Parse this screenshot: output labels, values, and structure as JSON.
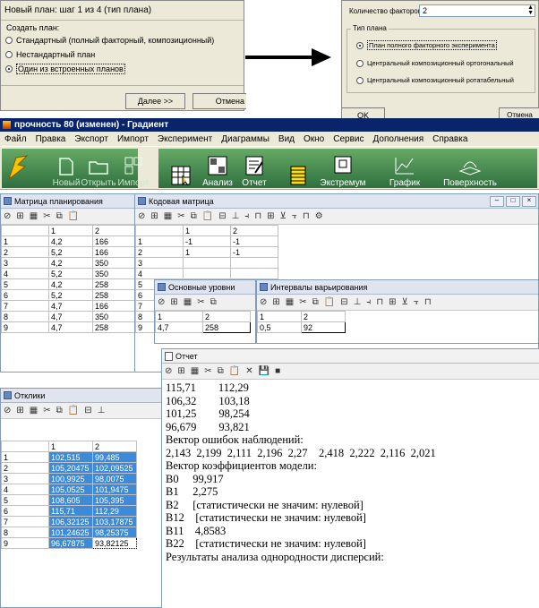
{
  "wizard": {
    "title": "Новый план: шаг 1 из 4 (тип плана)",
    "group_label": "Создать план:",
    "options": [
      {
        "label": "Стандартный (полный факторный, композиционный)",
        "selected": false
      },
      {
        "label": "Нестандартный план",
        "selected": false
      },
      {
        "label": "Один из встроенных планов",
        "selected": true
      }
    ],
    "next_label": "Далее >>",
    "cancel_label": "Отмена"
  },
  "wizard2": {
    "factors_label": "Количество факторов:",
    "factors_value": "2",
    "group_label": "Тип плана",
    "options": [
      {
        "label": "План полного факторного эксперимента",
        "selected": true
      },
      {
        "label": "Центральный композиционный ортогональный",
        "selected": false
      },
      {
        "label": "Центральный композиционный ротатабельный",
        "selected": false
      }
    ],
    "ok_label": "OK",
    "cancel_label": "Отмена"
  },
  "app": {
    "title": "прочность 80 (изменен) - Градиент",
    "menu": [
      "Файл",
      "Правка",
      "Экспорт",
      "Импорт",
      "Эксперимент",
      "Диаграммы",
      "Вид",
      "Окно",
      "Сервис",
      "Дополнения",
      "Справка"
    ],
    "toolbar": {
      "new": "Новый",
      "open": "Открыть",
      "import": "Импорт",
      "analysis": "Анализ",
      "report": "Отчет",
      "extremum": "Экстремум",
      "chart": "График",
      "surface": "Поверхность"
    }
  },
  "plan_matrix": {
    "title": "Матрица планирования",
    "headers": [
      "",
      "1",
      "2"
    ],
    "rows": [
      [
        "1",
        "4,2",
        "166"
      ],
      [
        "2",
        "5,2",
        "166"
      ],
      [
        "3",
        "4,2",
        "350"
      ],
      [
        "4",
        "5,2",
        "350"
      ],
      [
        "5",
        "4,2",
        "258"
      ],
      [
        "6",
        "5,2",
        "258"
      ],
      [
        "7",
        "4,7",
        "166"
      ],
      [
        "8",
        "4,7",
        "350"
      ],
      [
        "9",
        "4,7",
        "258"
      ]
    ]
  },
  "code_matrix": {
    "title": "Кодовая матрица",
    "headers": [
      "",
      "1",
      "2"
    ],
    "rows": [
      [
        "1",
        "-1",
        "-1"
      ],
      [
        "2",
        "1",
        "-1"
      ]
    ],
    "side_rows": [
      "3",
      "4",
      "5",
      "6",
      "7",
      "8",
      "9"
    ]
  },
  "base_levels": {
    "title": "Основные уровни",
    "headers": [
      "1",
      "2"
    ],
    "values": [
      "4,7",
      "258"
    ]
  },
  "intervals": {
    "title": "Интервалы варьирования",
    "headers": [
      "1",
      "2"
    ],
    "values": [
      "0,5",
      "92"
    ]
  },
  "responses": {
    "title": "Отклики",
    "headers": [
      "",
      "1",
      "2"
    ],
    "rows": [
      [
        "1",
        "102,515",
        "99,485"
      ],
      [
        "2",
        "105,20475",
        "102,09525"
      ],
      [
        "3",
        "100,9925",
        "98,0075"
      ],
      [
        "4",
        "105,0525",
        "101,9475"
      ],
      [
        "5",
        "108,605",
        "105,395"
      ],
      [
        "6",
        "115,71",
        "112,29"
      ],
      [
        "7",
        "106,32125",
        "103,17875"
      ],
      [
        "8",
        "101,24625",
        "98,25375"
      ],
      [
        "9",
        "96,67875",
        "93,82125"
      ]
    ]
  },
  "report": {
    "title": "Отчет",
    "lines": [
      "115,71        112,29",
      "106,32        103,18",
      "101,25        98,254",
      "96,679        93,821",
      "Вектор ошибок наблюдений:",
      "2,143  2,199  2,111  2,196  2,27    2,418  2,222  2,116  2,021",
      "Вектор коэффициентов модели:",
      "B0     99,917",
      "B1     2,275",
      "B2     [статистически не значим: нулевой]",
      "B12    [статистически не значим: нулевой]",
      "B11    4,8583",
      "B22    [статистически не значим: нулевой]",
      "Результаты анализа однородности дисперсий:"
    ]
  }
}
